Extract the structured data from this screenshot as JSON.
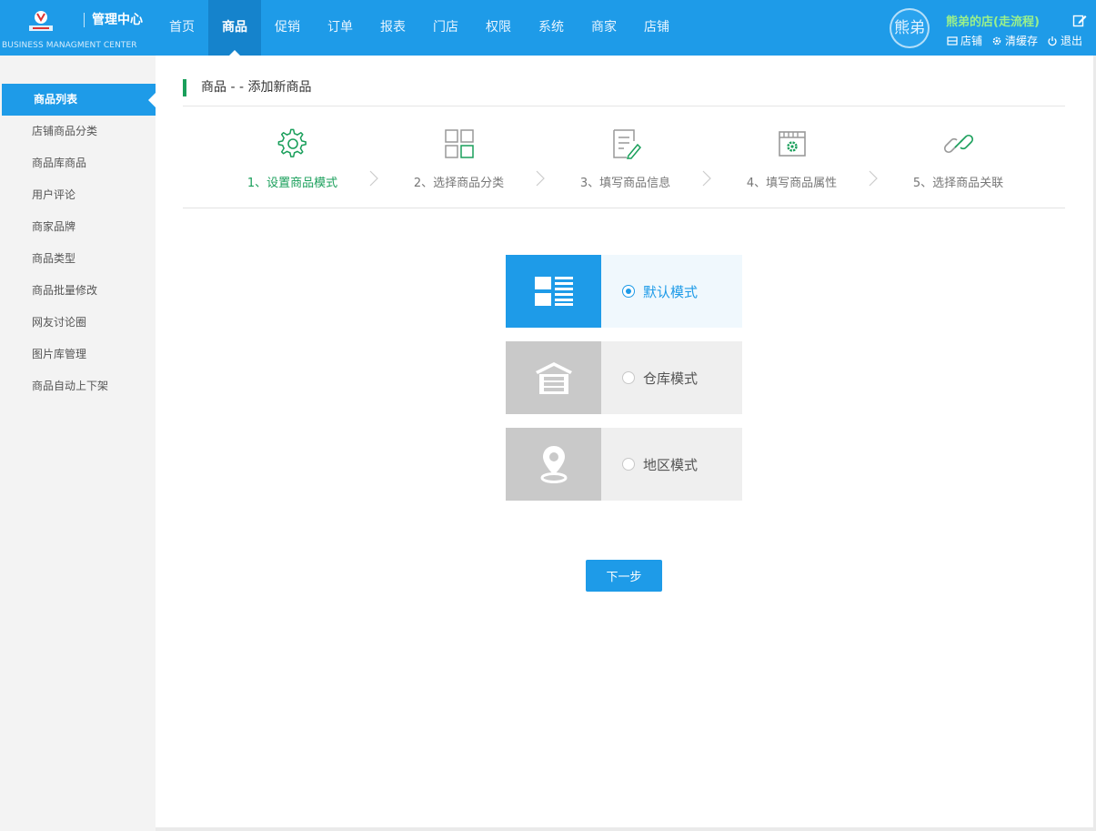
{
  "header": {
    "title": "管理中心",
    "subtitle": "BUSINESS MANAGMENT CENTER",
    "nav": [
      {
        "label": "首页",
        "active": false
      },
      {
        "label": "商品",
        "active": true
      },
      {
        "label": "促销",
        "active": false
      },
      {
        "label": "订单",
        "active": false
      },
      {
        "label": "报表",
        "active": false
      },
      {
        "label": "门店",
        "active": false
      },
      {
        "label": "权限",
        "active": false
      },
      {
        "label": "系统",
        "active": false
      },
      {
        "label": "商家",
        "active": false
      },
      {
        "label": "店铺",
        "active": false
      }
    ],
    "avatar_text": "熊弟",
    "shop_name": "熊弟的店(走流程)",
    "links": {
      "shop": "店铺",
      "clear_cache": "清缓存",
      "logout": "退出"
    }
  },
  "sidebar": {
    "items": [
      {
        "label": "商品列表",
        "active": true
      },
      {
        "label": "店铺商品分类",
        "active": false
      },
      {
        "label": "商品库商品",
        "active": false
      },
      {
        "label": "用户评论",
        "active": false
      },
      {
        "label": "商家品牌",
        "active": false
      },
      {
        "label": "商品类型",
        "active": false
      },
      {
        "label": "商品批量修改",
        "active": false
      },
      {
        "label": "网友讨论圈",
        "active": false
      },
      {
        "label": "图片库管理",
        "active": false
      },
      {
        "label": "商品自动上下架",
        "active": false
      }
    ]
  },
  "main": {
    "page_title": "商品 - - 添加新商品",
    "steps": [
      {
        "label": "1、设置商品模式",
        "icon": "gear-icon",
        "active": true
      },
      {
        "label": "2、选择商品分类",
        "icon": "grid-icon",
        "active": false
      },
      {
        "label": "3、填写商品信息",
        "icon": "edit-document-icon",
        "active": false
      },
      {
        "label": "4、填写商品属性",
        "icon": "settings-window-icon",
        "active": false
      },
      {
        "label": "5、选择商品关联",
        "icon": "link-icon",
        "active": false
      }
    ],
    "modes": [
      {
        "label": "默认模式",
        "icon": "list-layout-icon",
        "selected": true
      },
      {
        "label": "仓库模式",
        "icon": "warehouse-icon",
        "selected": false
      },
      {
        "label": "地区模式",
        "icon": "location-pin-icon",
        "selected": false
      }
    ],
    "next_button": "下一步"
  },
  "colors": {
    "primary": "#1e9be8",
    "primary_dark": "#1583cc",
    "step_active": "#1a9f5b",
    "shop_name": "#9af08b",
    "inactive_tile": "#c9c9c9"
  }
}
